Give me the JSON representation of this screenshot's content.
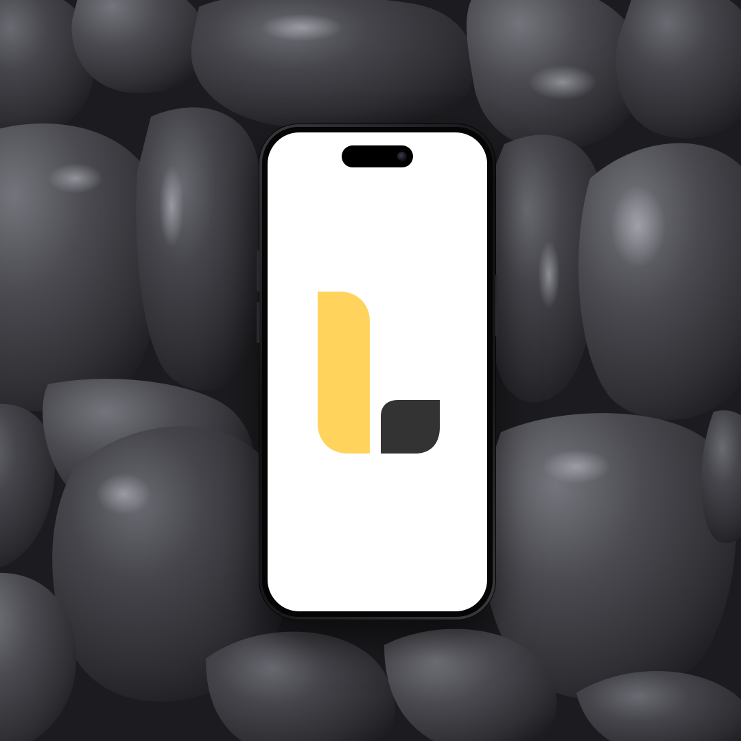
{
  "scene": {
    "background_color": "#1c1c20",
    "pebble_color": "#3d3d42",
    "pebble_highlight": "#8a8a92"
  },
  "device": {
    "type": "smartphone",
    "frame_color": "#101012",
    "screen_color": "#ffffff"
  },
  "app_logo": {
    "icon": "letter-l-logo-icon",
    "primary_color": "#ffd35c",
    "secondary_color": "#333333"
  }
}
